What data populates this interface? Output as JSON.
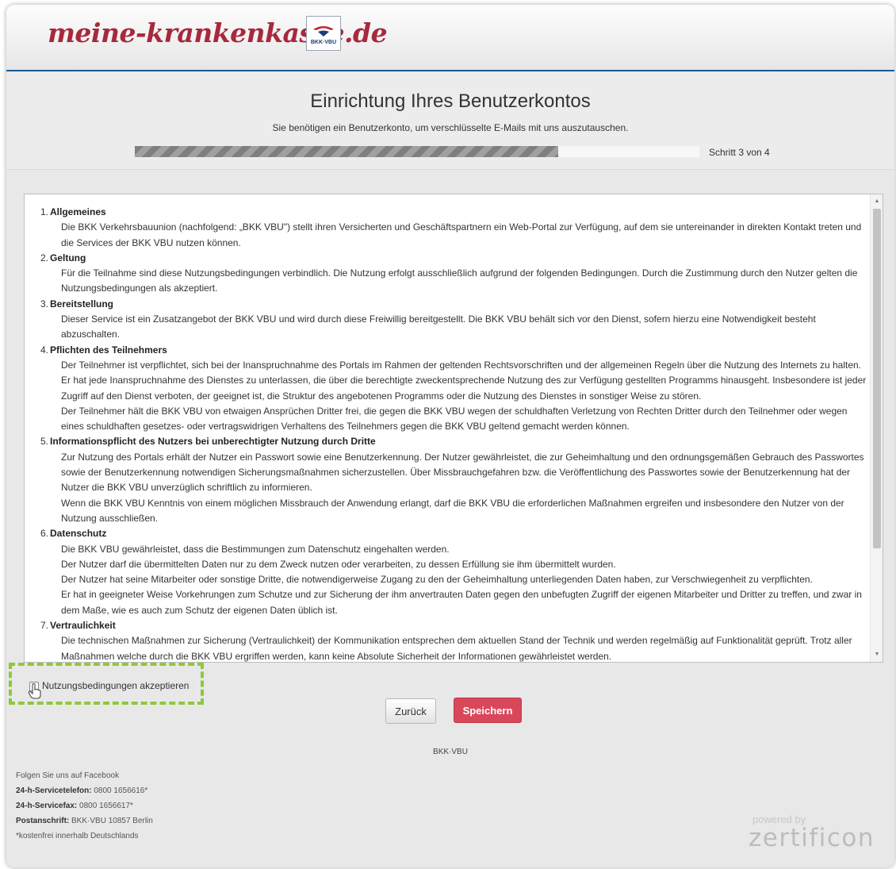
{
  "header": {
    "logo_text": "meine-krankenkasse.de",
    "badge_text": "BKK·VBU"
  },
  "setup": {
    "title": "Einrichtung Ihres Benutzerkontos",
    "subtitle": "Sie benötigen ein Benutzerkonto, um verschlüsselte E-Mails mit uns auszutauschen.",
    "step_label": "Schritt 3 von 4",
    "progress_fraction": 0.75
  },
  "terms": [
    {
      "num": "1.",
      "heading": "Allgemeines",
      "paragraphs": [
        "Die BKK Verkehrsbauunion (nachfolgend: „BKK VBU\") stellt ihren Versicherten und Geschäftspartnern ein Web-Portal zur Verfügung, auf dem sie untereinander in direkten Kontakt treten und die Services der BKK VBU nutzen können."
      ]
    },
    {
      "num": "2.",
      "heading": "Geltung",
      "paragraphs": [
        "Für die Teilnahme sind diese Nutzungsbedingungen verbindlich. Die Nutzung erfolgt ausschließlich aufgrund der folgenden Bedingungen. Durch die Zustimmung durch den Nutzer gelten die Nutzungsbedingungen als akzeptiert."
      ]
    },
    {
      "num": "3.",
      "heading": "Bereitstellung",
      "paragraphs": [
        "Dieser Service ist ein Zusatzangebot der BKK VBU und wird durch diese Freiwillig bereitgestellt. Die BKK VBU behält sich vor den Dienst, sofern hierzu eine Notwendigkeit besteht abzuschalten."
      ]
    },
    {
      "num": "4.",
      "heading": "Pflichten des Teilnehmers",
      "paragraphs": [
        "Der Teilnehmer ist verpflichtet, sich bei der Inanspruchnahme des Portals im Rahmen der geltenden Rechtsvorschriften und der allgemeinen Regeln über die Nutzung des Internets zu halten. Er hat jede Inanspruchnahme des Dienstes zu unterlassen, die über die berechtigte zweckentsprechende Nutzung des zur Verfügung gestellten Programms hinausgeht. Insbesondere ist jeder Zugriff auf den Dienst verboten, der geeignet ist, die Struktur des angebotenen Programms oder die Nutzung des Dienstes in sonstiger Weise zu stören.",
        "Der Teilnehmer hält die BKK VBU von etwaigen Ansprüchen Dritter frei, die gegen die BKK VBU wegen der schuldhaften Verletzung von Rechten Dritter durch den Teilnehmer oder wegen eines schuldhaften gesetzes- oder vertragswidrigen Verhaltens des Teilnehmers gegen die BKK VBU geltend gemacht werden können."
      ]
    },
    {
      "num": "5.",
      "heading": "Informationspflicht des Nutzers bei unberechtigter Nutzung durch Dritte",
      "paragraphs": [
        "Zur Nutzung des Portals erhält der Nutzer ein Passwort sowie eine Benutzerkennung. Der Nutzer gewährleistet, die zur Geheimhaltung und den ordnungsgemäßen Gebrauch des Passwortes sowie der Benutzerkennung notwendigen Sicherungsmaßnahmen sicherzustellen. Über Missbrauchgefahren bzw. die Veröffentlichung des Passwortes sowie der Benutzerkennung hat der Nutzer die BKK VBU unverzüglich schriftlich zu informieren.",
        "Wenn die BKK VBU Kenntnis von einem möglichen Missbrauch der Anwendung erlangt, darf die BKK VBU die erforderlichen Maßnahmen ergreifen und insbesondere den Nutzer von der Nutzung ausschließen."
      ]
    },
    {
      "num": "6.",
      "heading": "Datenschutz",
      "paragraphs": [
        "Die BKK VBU gewährleistet, dass die Bestimmungen zum Datenschutz eingehalten werden.",
        "Der Nutzer darf die übermittelten Daten nur zu dem Zweck nutzen oder verarbeiten, zu dessen Erfüllung sie ihm übermittelt wurden.",
        "Der Nutzer hat seine Mitarbeiter oder sonstige Dritte, die notwendigerweise Zugang zu den der Geheimhaltung unterliegenden Daten haben, zur Verschwiegenheit zu verpflichten.",
        "Er hat in geeigneter Weise Vorkehrungen zum Schutze und zur Sicherung der ihm anvertrauten Daten gegen den unbefugten Zugriff der eigenen Mitarbeiter und Dritter zu treffen, und zwar in dem Maße, wie es auch zum Schutz der eigenen Daten üblich ist."
      ]
    },
    {
      "num": "7.",
      "heading": "Vertraulichkeit",
      "paragraphs": [
        "Die technischen Maßnahmen zur Sicherung (Vertraulichkeit) der Kommunikation entsprechen dem aktuellen Stand der Technik und werden regelmäßig auf Funktionalität geprüft. Trotz aller Maßnahmen welche durch die BKK VBU ergriffen werden, kann keine Absolute Sicherheit der Informationen gewährleistet werden."
      ]
    }
  ],
  "accept": {
    "label": "Nutzungsbedingungen akzeptieren",
    "checked": false
  },
  "buttons": {
    "back": "Zurück",
    "save": "Speichern"
  },
  "brand_small": "BKK·VBU",
  "footer": {
    "facebook": "Folgen Sie uns auf Facebook",
    "phone_label": "24-h-Servicetelefon:",
    "phone_value": " 0800 1656616*",
    "fax_label": "24-h-Servicefax:",
    "fax_value": " 0800 1656617*",
    "address_label": "Postanschrift:",
    "address_value": " BKK·VBU 10857 Berlin",
    "note": "*kostenfrei innerhalb Deutschlands",
    "powered_by": "powered by",
    "vendor": "zertificon"
  },
  "colors": {
    "accent_blue": "#1b5c9a",
    "logo_red": "#a8283d",
    "save_button": "#d9475a",
    "highlight_green": "#8fc83a"
  }
}
